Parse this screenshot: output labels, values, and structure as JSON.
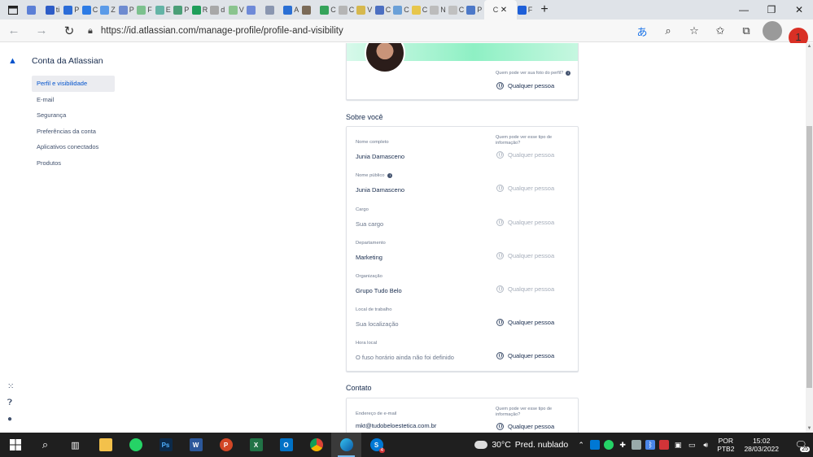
{
  "browser": {
    "tabs": [
      {
        "letter": "",
        "color": "#5b7fd6"
      },
      {
        "letter": "ti",
        "color": "#2d5cc7"
      },
      {
        "letter": "P",
        "color": "#2b6cd8"
      },
      {
        "letter": "C",
        "color": "#2c7be5"
      },
      {
        "letter": "Z",
        "color": "#5a9ae8"
      },
      {
        "letter": "P",
        "color": "#6e8bd0"
      },
      {
        "letter": "F",
        "color": "#7cc18e"
      },
      {
        "letter": "E",
        "color": "#64b4a6"
      },
      {
        "letter": "P",
        "color": "#4b9f78"
      },
      {
        "letter": "R",
        "color": "#1e9e5a"
      },
      {
        "letter": "d",
        "color": "#a8a8a8"
      },
      {
        "letter": "V",
        "color": "#8ac48e"
      },
      {
        "letter": "",
        "color": "#6f8ad8"
      },
      {
        "letter": "",
        "color": "#8a96b0"
      },
      {
        "letter": "A",
        "color": "#2a6fd4"
      },
      {
        "letter": "",
        "color": "#7b6b58"
      },
      {
        "letter": "C",
        "color": "#35a35a"
      },
      {
        "letter": "C",
        "color": "#b5b5b5"
      },
      {
        "letter": "V",
        "color": "#d6b84e"
      },
      {
        "letter": "C",
        "color": "#4c6fc1"
      },
      {
        "letter": "C",
        "color": "#6aa0d8"
      },
      {
        "letter": "C",
        "color": "#e7c64b"
      },
      {
        "letter": "N",
        "color": "#bcbcbc"
      },
      {
        "letter": "C",
        "color": "#c0c0c0"
      },
      {
        "letter": "P",
        "color": "#4c78c8"
      }
    ],
    "active_tab": {
      "letter": "C",
      "color": "#2a2a2a"
    },
    "after_tab": {
      "letter": "F",
      "color": "#1e5fd8"
    },
    "url": "https://id.atlassian.com/manage-profile/profile-and-visibility",
    "notification_count": "1"
  },
  "sidebar": {
    "title": "Conta da Atlassian",
    "items": [
      {
        "label": "Perfil e visibilidade",
        "active": true
      },
      {
        "label": "E-mail"
      },
      {
        "label": "Segurança"
      },
      {
        "label": "Preferências da conta"
      },
      {
        "label": "Aplicativos conectados"
      },
      {
        "label": "Produtos"
      }
    ]
  },
  "header_card": {
    "photo_question": "Quem pode ver sua foto do perfil?",
    "photo_visibility": "Qualquer pessoa"
  },
  "about": {
    "title": "Sobre você",
    "question": "Quem pode ver esse tipo de informação?",
    "fields": [
      {
        "label": "Nome completo",
        "value": "Junia Damasceno",
        "visibility": "Qualquer pessoa",
        "locked": true
      },
      {
        "label": "Nome público",
        "value": "Junia Damasceno",
        "visibility": "Qualquer pessoa",
        "locked": true,
        "info": true
      },
      {
        "label": "Cargo",
        "value": "Sua cargo",
        "visibility": "Qualquer pessoa",
        "locked": true,
        "placeholder": true
      },
      {
        "label": "Departamento",
        "value": "Marketing",
        "visibility": "Qualquer pessoa",
        "locked": true
      },
      {
        "label": "Organização",
        "value": "Grupo Tudo Belo",
        "visibility": "Qualquer pessoa",
        "locked": true
      },
      {
        "label": "Local de trabalho",
        "value": "Sua localização",
        "visibility": "Qualquer pessoa",
        "locked": false,
        "placeholder": true
      },
      {
        "label": "Hora local",
        "value": "O fuso horário ainda não foi definido",
        "visibility": "Qualquer pessoa",
        "locked": false,
        "placeholder": true
      }
    ]
  },
  "contact": {
    "title": "Contato",
    "question": "Quem pode ver esse tipo de informação?",
    "email_label": "Endereço de e-mail",
    "email_value": "mkt@tudobeloestetica.com.br",
    "email_visibility": "Qualquer pessoa"
  },
  "taskbar": {
    "weather_temp": "30°C",
    "weather_text": "Pred. nublado",
    "lang_1": "POR",
    "lang_2": "PTB2",
    "time": "15:02",
    "date": "28/03/2022",
    "notifications": "25",
    "edge_badge": "4"
  }
}
